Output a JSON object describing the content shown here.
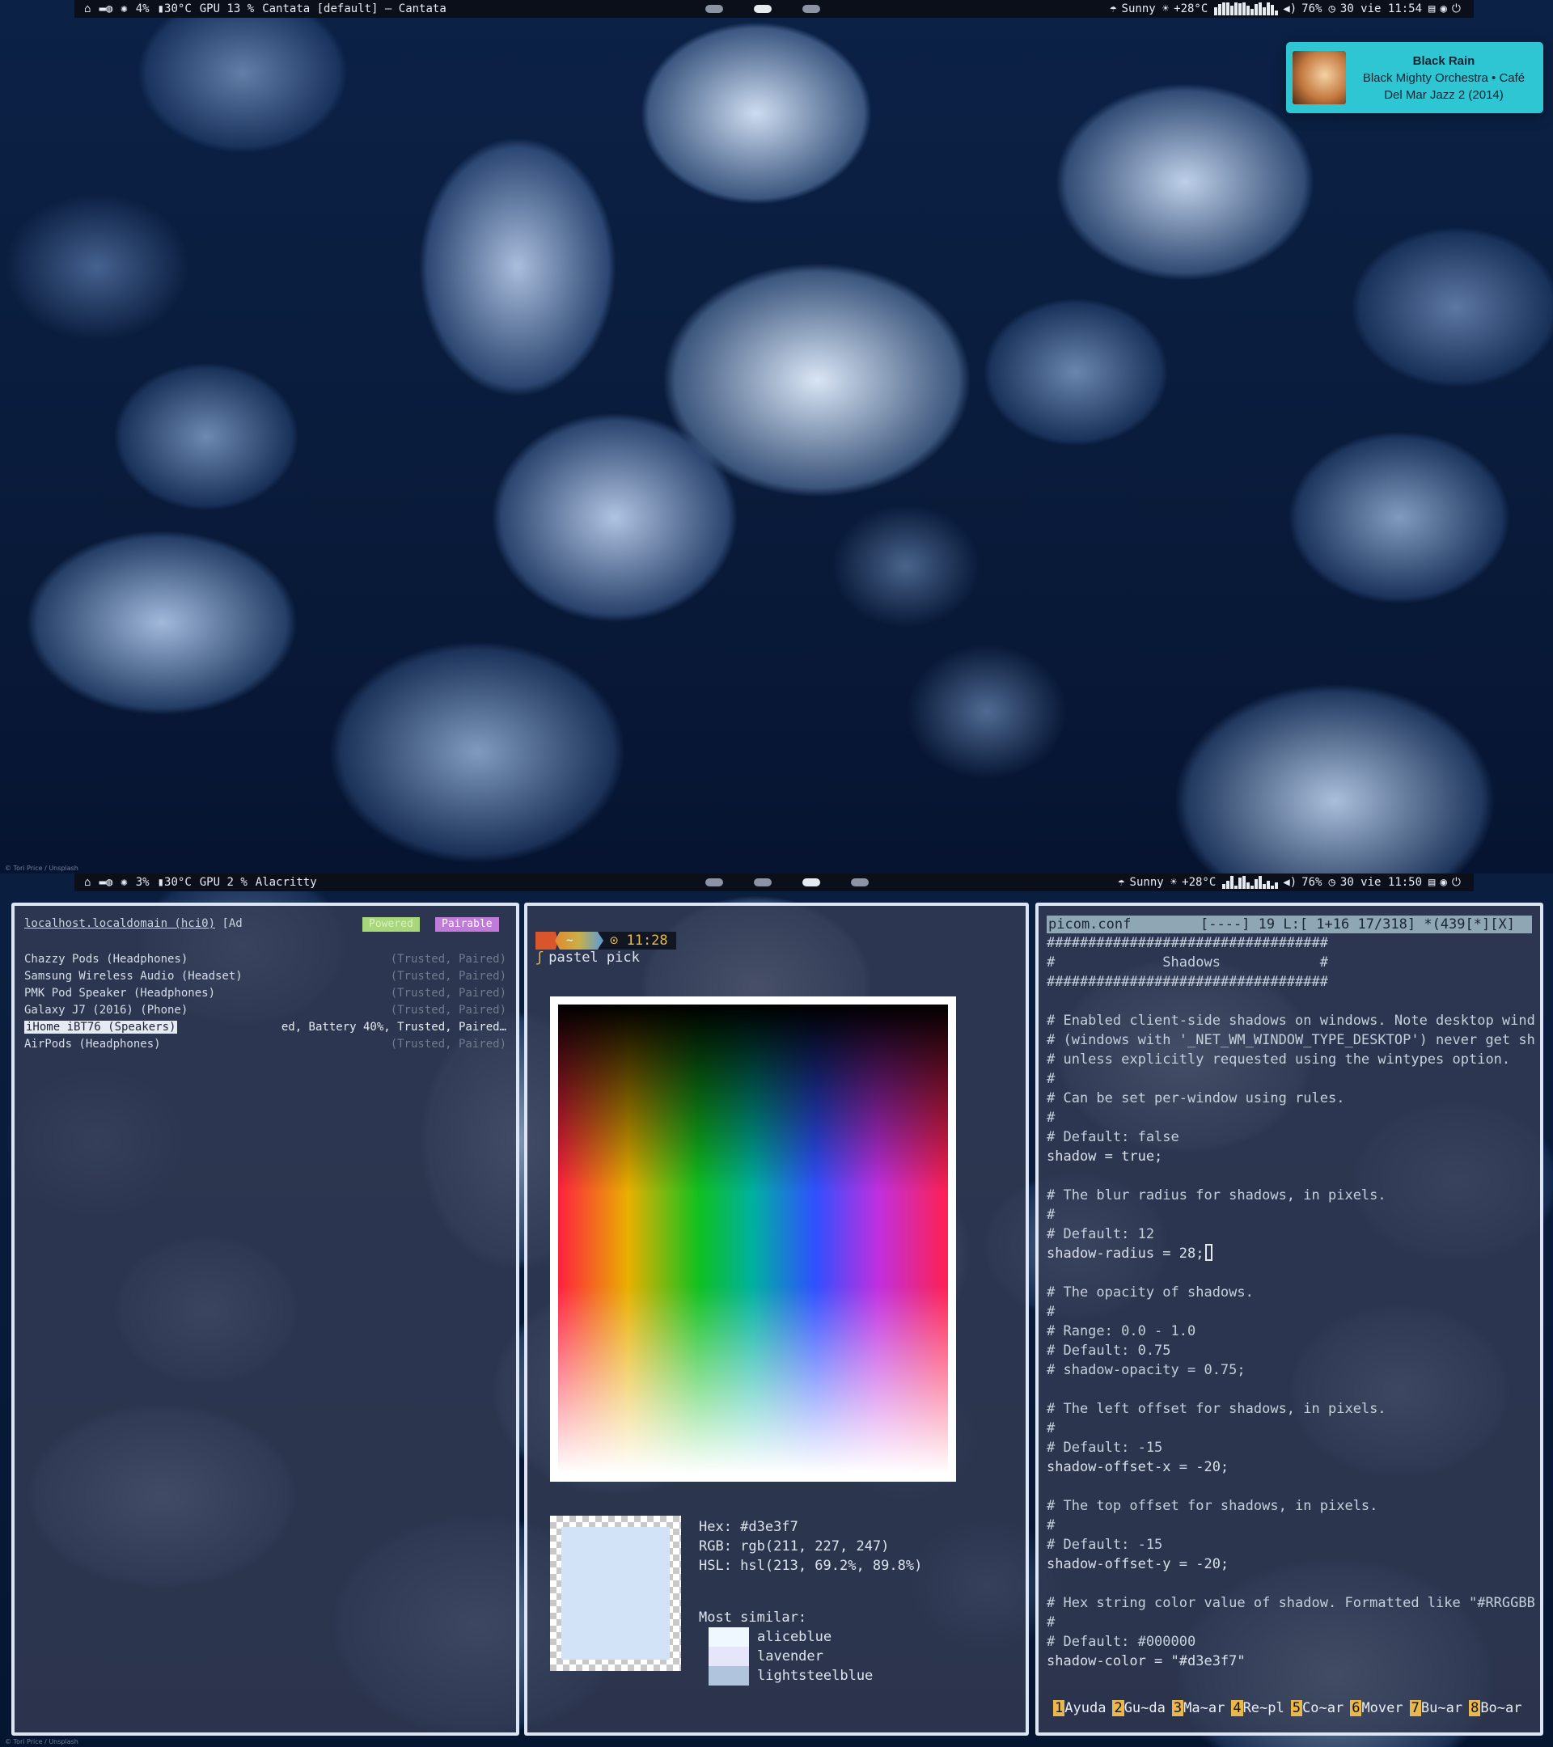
{
  "screen1": {
    "topbar": {
      "cpu": "4%",
      "temp": "30°C",
      "gpu": "GPU 13 %",
      "title": "Cantata [default] — Cantata",
      "weather": "Sunny",
      "outside_temp": "+28°C",
      "volume": "76%",
      "clock": "30 vie 11:54"
    },
    "notification": {
      "title": "Black Rain",
      "line2": "Black Mighty Orchestra • Café",
      "line3": "Del Mar Jazz 2 (2014)"
    }
  },
  "screen2": {
    "topbar": {
      "cpu": "3%",
      "temp": "30°C",
      "gpu": "GPU 2 %",
      "title": "Alacritty",
      "weather": "Sunny",
      "outside_temp": "+28°C",
      "volume": "76%",
      "clock": "30 vie 11:50"
    },
    "bluetooth": {
      "controller": "localhost.localdomain (hci0)",
      "controller_tail": "[Ad",
      "badge_powered": "Powered",
      "badge_pairable": "Pairable",
      "devices": [
        {
          "name": "Chazzy Pods (Headphones)",
          "status": "(Trusted, Paired)"
        },
        {
          "name": "Samsung Wireless Audio (Headset)",
          "status": "(Trusted, Paired)"
        },
        {
          "name": "PMK Pod Speaker (Headphones)",
          "status": "(Trusted, Paired)"
        },
        {
          "name": "Galaxy J7 (2016) (Phone)",
          "status": "(Trusted, Paired)"
        },
        {
          "name": "iHome iBT76 (Speakers)",
          "status": "ed, Battery 40%, Trusted, Paired…"
        },
        {
          "name": "AirPods (Headphones)",
          "status": "(Trusted, Paired)"
        }
      ]
    },
    "pastel": {
      "dir": "~",
      "time": "⊙ 11:28",
      "command": "pastel pick",
      "hex": "Hex: #d3e3f7",
      "rgb": "RGB: rgb(211, 227, 247)",
      "hsl": "HSL: hsl(213, 69.2%, 89.8%)",
      "similar_label": "Most similar:",
      "similar": [
        {
          "name": "aliceblue",
          "color": "#f0f8ff"
        },
        {
          "name": "lavender",
          "color": "#e6e6fa"
        },
        {
          "name": "lightsteelblue",
          "color": "#b0c4de"
        }
      ],
      "swatch_color": "#d3e3f7"
    },
    "editor": {
      "filename": "picom.conf",
      "status": "[----] 19 L:[  1+16  17/318] *(439[*][X]",
      "lines": [
        "##################################",
        "#             Shadows            #",
        "##################################",
        "",
        "# Enabled client-side shadows on windows. Note desktop wind",
        "# (windows with '_NET_WM_WINDOW_TYPE_DESKTOP') never get sh",
        "# unless explicitly requested using the wintypes option.",
        "#",
        "# Can be set per-window using rules.",
        "#",
        "# Default: false",
        "shadow = true;",
        "",
        "# The blur radius for shadows, in pixels.",
        "#",
        "# Default: 12",
        "shadow-radius = 28;",
        "",
        "# The opacity of shadows.",
        "#",
        "# Range: 0.0 - 1.0",
        "# Default: 0.75",
        "# shadow-opacity = 0.75;",
        "",
        "# The left offset for shadows, in pixels.",
        "#",
        "# Default: -15",
        "shadow-offset-x = -20;",
        "",
        "# The top offset for shadows, in pixels.",
        "#",
        "# Default: -15",
        "shadow-offset-y = -20;",
        "",
        "# Hex string color value of shadow. Formatted like \"#RRGGBB",
        "#",
        "# Default: #000000",
        "shadow-color = \"#d3e3f7\""
      ],
      "keys": [
        {
          "n": "1",
          "l": "Ayuda"
        },
        {
          "n": "2",
          "l": "Gu~da"
        },
        {
          "n": "3",
          "l": "Ma~ar"
        },
        {
          "n": "4",
          "l": "Re~pl"
        },
        {
          "n": "5",
          "l": "Co~ar"
        },
        {
          "n": "6",
          "l": "Mover"
        },
        {
          "n": "7",
          "l": "Bu~ar"
        },
        {
          "n": "8",
          "l": "Bo~ar"
        }
      ]
    }
  },
  "colors": {
    "accent_notification": "#2ec6d3",
    "window_border": "#dbe5f3",
    "prompt": "#e9b84c"
  }
}
